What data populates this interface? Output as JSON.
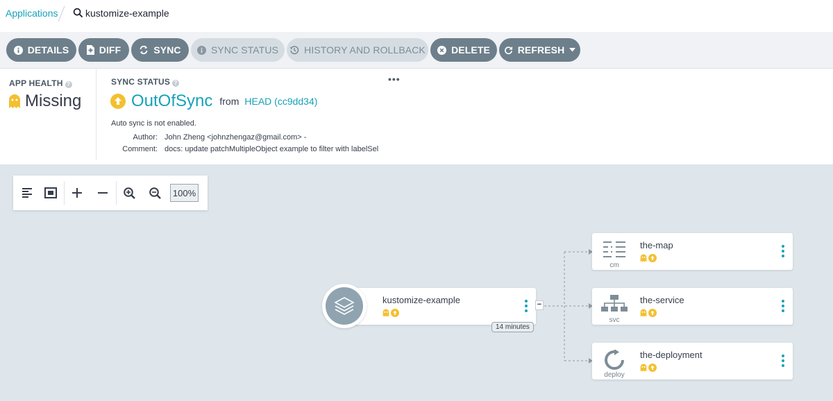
{
  "breadcrumb": {
    "root_label": "Applications",
    "current": "kustomize-example",
    "search_icon": "search-icon"
  },
  "toolbar": {
    "buttons": [
      {
        "label": "DETAILS",
        "icon": "info-icon",
        "enabled": true
      },
      {
        "label": "DIFF",
        "icon": "file-diff-icon",
        "enabled": true
      },
      {
        "label": "SYNC",
        "icon": "sync-icon",
        "enabled": true
      },
      {
        "label": "SYNC STATUS",
        "icon": "info-icon",
        "enabled": false
      },
      {
        "label": "HISTORY AND ROLLBACK",
        "icon": "history-icon",
        "enabled": false
      },
      {
        "label": "DELETE",
        "icon": "close-circle-icon",
        "enabled": true
      },
      {
        "label": "REFRESH",
        "icon": "refresh-icon",
        "enabled": true
      }
    ]
  },
  "app_health": {
    "title": "APP HEALTH",
    "value": "Missing",
    "icon": "ghost-icon"
  },
  "sync_status": {
    "title": "SYNC STATUS",
    "value": "OutOfSync",
    "from_label": "from",
    "revision": "HEAD (cc9dd34)",
    "icon": "arrow-up-circle-icon",
    "auto_sync": "Auto sync is not enabled.",
    "author_label": "Author:",
    "author": "John Zheng <johnzhengaz@gmail.com> -",
    "comment_label": "Comment:",
    "comment": "docs: update patchMultipleObject example to filter with labelSel"
  },
  "graph": {
    "zoom": "100%",
    "app_node": {
      "name": "kustomize-example",
      "age": "14 minutes"
    },
    "resources": [
      {
        "name": "the-map",
        "kind": "cm",
        "icon": "configmap-icon"
      },
      {
        "name": "the-service",
        "kind": "svc",
        "icon": "service-icon"
      },
      {
        "name": "the-deployment",
        "kind": "deploy",
        "icon": "deployment-icon"
      }
    ]
  },
  "colors": {
    "accent": "#17a2b8",
    "button": "#6d7f8b",
    "button_disabled": "#d5dde3",
    "warning": "#f4c030",
    "canvas": "#dee6eb"
  }
}
